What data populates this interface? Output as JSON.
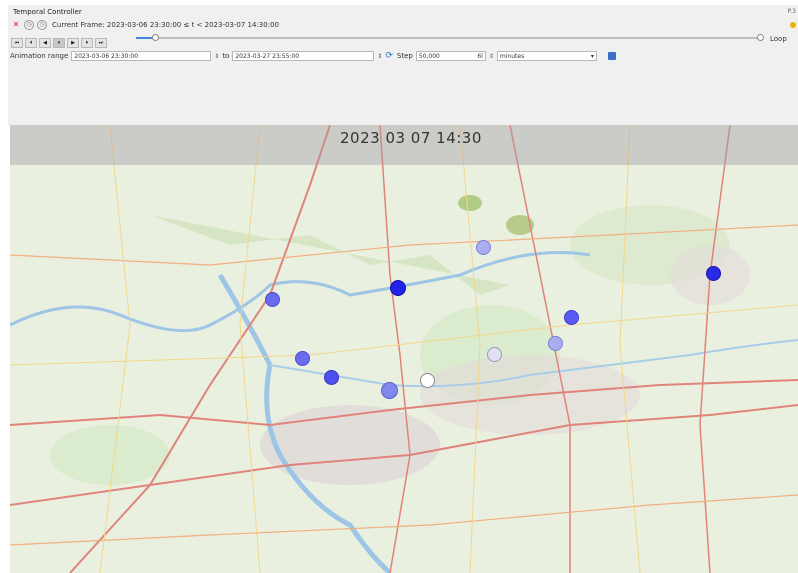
{
  "controller": {
    "title": "Temporal Controller",
    "corner_text": "P.3",
    "current_frame": "Current Frame: 2023-03-06 23:30:00 ≤ t < 2023-03-07 14:30:00",
    "loop_label": "Loop"
  },
  "nav_icons": [
    "skip-back-icon",
    "step-back-icon",
    "play-back-icon",
    "pause-icon",
    "play-icon",
    "step-forward-icon",
    "skip-forward-icon"
  ],
  "nav_glyphs": [
    "⏮",
    "⏴",
    "◀",
    "⏸",
    "▶",
    "⏵",
    "⏭"
  ],
  "slider": {
    "position_fraction": 0.03
  },
  "range": {
    "label": "Animation range",
    "start": "2023-03-06 23:30:00",
    "to_label": "to",
    "end": "2023-03-27 23:55:00",
    "step_label": "Step",
    "step_value": "50,000",
    "step_extra": "6l",
    "unit": "minutes"
  },
  "map": {
    "timestamp": "2023 03 07 14:30"
  },
  "colors": {
    "accent": "#3d86d8",
    "marker_dark": "#2323e8",
    "marker_mid": "#6b6bf0",
    "marker_light": "#a8aef0",
    "marker_pale": "#e2e0f4",
    "marker_white": "#ffffff"
  }
}
